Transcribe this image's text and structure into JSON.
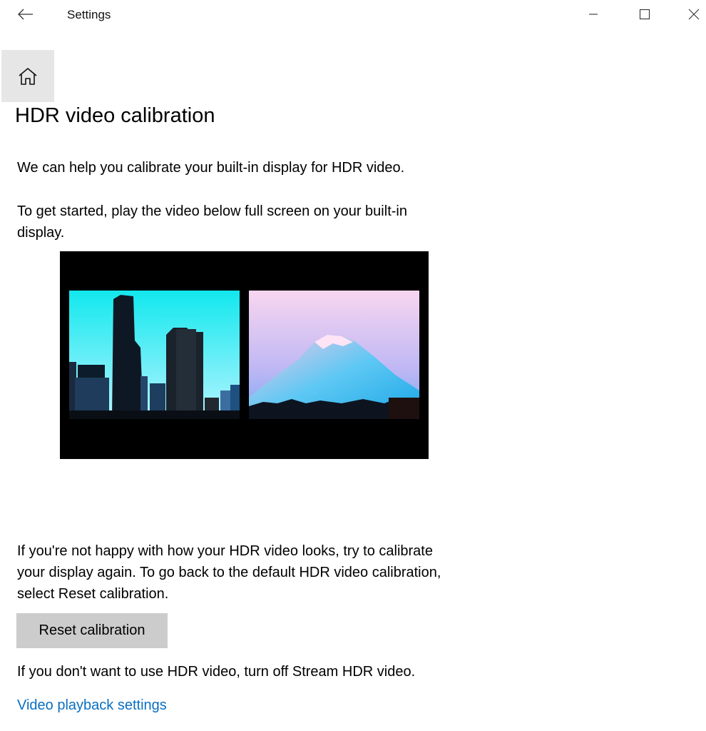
{
  "window": {
    "title": "Settings",
    "back_icon": "arrow-left-icon",
    "minimize_icon": "minimize-icon",
    "maximize_icon": "maximize-icon",
    "close_icon": "close-icon"
  },
  "nav": {
    "home_icon": "home-icon"
  },
  "page": {
    "title": "HDR video calibration",
    "intro": "We can help you calibrate your built-in display for HDR video.",
    "instructions_line1": "To get started, play the video below full screen on your built-in",
    "instructions_line2": "display.",
    "recalibrate_line1": "If you're not happy with how your HDR video looks, try to calibrate",
    "recalibrate_line2": "your display again. To go back to the default HDR video calibration,",
    "recalibrate_line3": "select Reset calibration.",
    "reset_button_label": "Reset calibration",
    "turn_off_text": "If you don't want to use HDR video, turn off Stream HDR video.",
    "video_playback_link": "Video playback settings"
  },
  "video": {
    "thumbnails": [
      "city-skyline-image",
      "mountain-image"
    ]
  },
  "colors": {
    "link": "#0a6fc2",
    "button_bg": "#cccccc",
    "home_bg": "#e6e6e6"
  }
}
